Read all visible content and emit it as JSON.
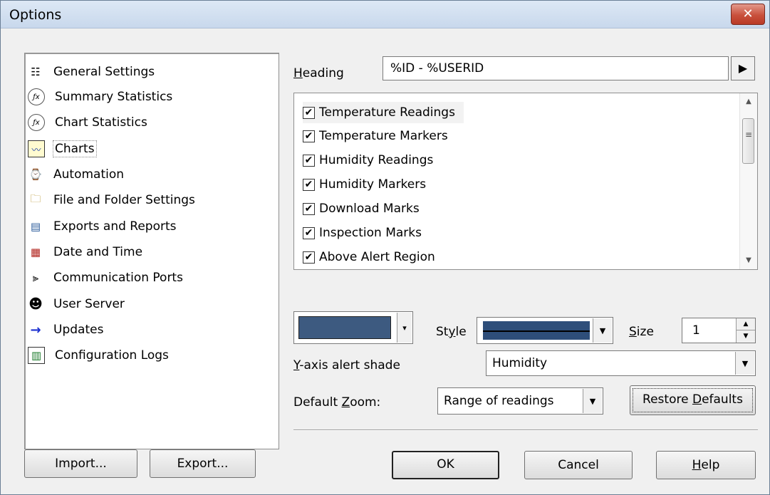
{
  "window": {
    "title": "Options",
    "close_label": "✕"
  },
  "nav": {
    "items": [
      {
        "label": "General Settings",
        "icon": "general-settings-icon",
        "glyph": "☷"
      },
      {
        "label": "Summary Statistics",
        "icon": "summary-statistics-icon",
        "glyph": "ƒx"
      },
      {
        "label": "Chart Statistics",
        "icon": "chart-statistics-icon",
        "glyph": "ƒx"
      },
      {
        "label": "Charts",
        "icon": "charts-icon",
        "glyph": "〰"
      },
      {
        "label": "Automation",
        "icon": "watch-icon",
        "glyph": "⌚"
      },
      {
        "label": "File and Folder Settings",
        "icon": "folder-icon",
        "glyph": "🗀"
      },
      {
        "label": "Exports and Reports",
        "icon": "report-icon",
        "glyph": "▤"
      },
      {
        "label": "Date and Time",
        "icon": "calendar-icon",
        "glyph": "▦"
      },
      {
        "label": "Communication Ports",
        "icon": "port-icon",
        "glyph": "⫸"
      },
      {
        "label": "User Server",
        "icon": "user-server-icon",
        "glyph": "☻"
      },
      {
        "label": "Updates",
        "icon": "arrow-right-icon",
        "glyph": "→"
      },
      {
        "label": "Configuration Logs",
        "icon": "log-icon",
        "glyph": "▥"
      }
    ]
  },
  "heading": {
    "label_first": "H",
    "label_rest": "eading",
    "value": "%ID - %USERID",
    "button_icon": "▶"
  },
  "list": {
    "items": [
      {
        "label": "Temperature Readings",
        "checked": "✔"
      },
      {
        "label": "Temperature Markers",
        "checked": "✔"
      },
      {
        "label": "Humidity Readings",
        "checked": "✔"
      },
      {
        "label": "Humidity Markers",
        "checked": "✔"
      },
      {
        "label": "Download Marks",
        "checked": "✔"
      },
      {
        "label": "Inspection Marks",
        "checked": "✔"
      },
      {
        "label": "Above Alert Region",
        "checked": "✔"
      }
    ],
    "scroll_up": "▲",
    "scroll_down": "▼",
    "grip": "≡"
  },
  "appearance": {
    "color": "#3d5a80",
    "style_label_pre": "St",
    "style_label_u": "y",
    "style_label_post": "le",
    "size_label_u": "S",
    "size_label_rest": "ize",
    "size_value": "1",
    "spin_up": "▲",
    "spin_down": "▼",
    "dropdown_arrow": "▼",
    "small_arrow": "▾"
  },
  "yaxis": {
    "label_u": "Y",
    "label_rest": "-axis alert shade",
    "value": "Humidity"
  },
  "zoom": {
    "label_pre": "Default ",
    "label_u": "Z",
    "label_post": "oom:",
    "value": "Range of readings"
  },
  "buttons": {
    "restore_pre": "Restore ",
    "restore_u": "D",
    "restore_post": "efaults",
    "import": "Import...",
    "export": "Export...",
    "ok": "OK",
    "cancel": "Cancel",
    "help_u": "H",
    "help_rest": "elp"
  }
}
